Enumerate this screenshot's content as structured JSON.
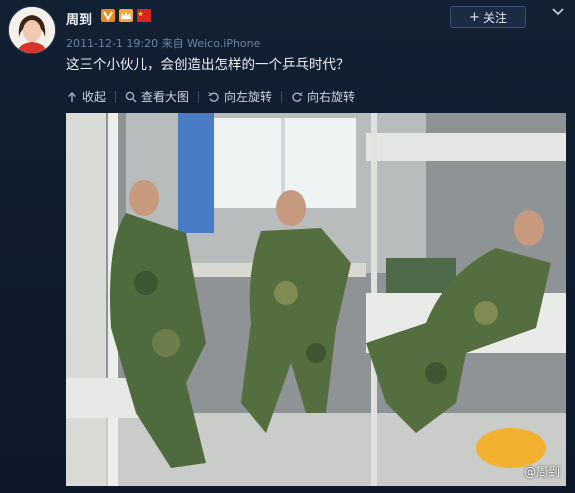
{
  "post": {
    "author": "周到",
    "timestamp": "2011-12-1 19:20",
    "source_prefix": "来自",
    "source": "Weico.iPhone",
    "text": "这三个小伙儿，会创造出怎样的一个乒乓时代？"
  },
  "header": {
    "follow_label": "关注"
  },
  "toolbar": {
    "collapse_label": "收起",
    "view_large_label": "查看大图",
    "rotate_left_label": "向左旋转",
    "rotate_right_label": "向右旋转"
  },
  "photo": {
    "watermark": "@周到"
  },
  "colors": {
    "background": "#0e1828",
    "verified_badge": "#f08a1c",
    "flag": "#d9261c"
  },
  "icons": [
    "verified-icon",
    "crown-icon",
    "flag-icon",
    "plus-icon",
    "chevron-down-icon",
    "arrow-up-icon",
    "search-icon",
    "rotate-left-icon",
    "rotate-right-icon"
  ]
}
